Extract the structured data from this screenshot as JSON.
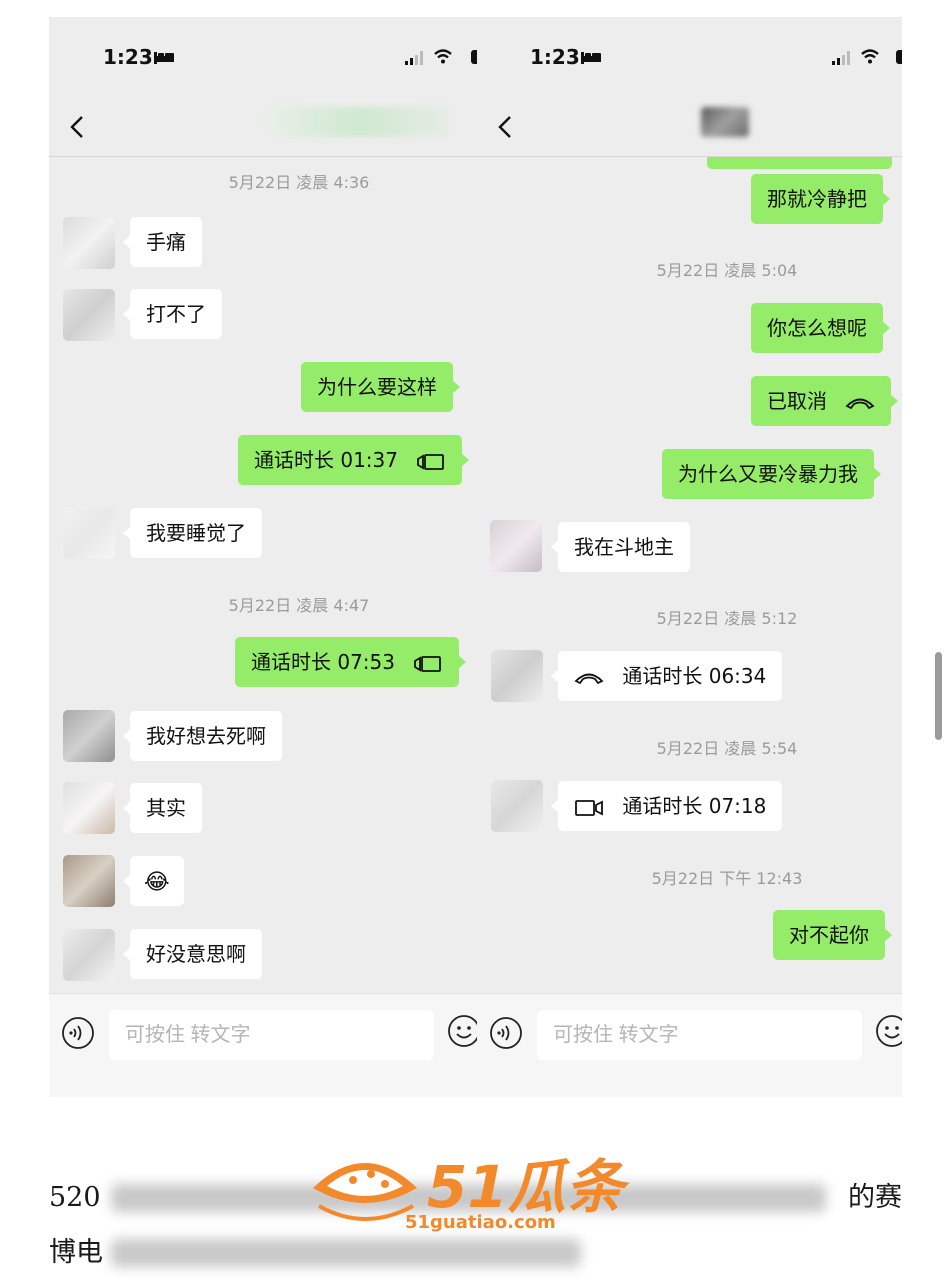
{
  "status_bar": {
    "time": "1:23"
  },
  "left_chat": {
    "timestamps": [
      "5月22日 凌晨 4:36",
      "5月22日 凌晨 4:47"
    ],
    "messages": [
      {
        "dir": "in",
        "text": "手痛"
      },
      {
        "dir": "in",
        "text": "打不了"
      },
      {
        "dir": "out",
        "text": "为什么要这样"
      },
      {
        "dir": "out",
        "text": "通话时长 01:37",
        "icon": "video-call-icon"
      },
      {
        "dir": "in",
        "text": "我要睡觉了"
      },
      {
        "dir": "out",
        "text": "通话时长 07:53",
        "icon": "video-call-icon"
      },
      {
        "dir": "in",
        "text": "我好想去死啊"
      },
      {
        "dir": "in",
        "text": "其实"
      },
      {
        "dir": "in",
        "text": "😂",
        "icon": "laughing-emoji-icon"
      },
      {
        "dir": "in",
        "text": "好没意思啊"
      }
    ]
  },
  "right_chat": {
    "timestamps": [
      "5月22日 凌晨 5:04",
      "5月22日 凌晨 5:12",
      "5月22日 凌晨 5:54",
      "5月22日 下午 12:43"
    ],
    "messages": [
      {
        "dir": "out",
        "text": "那就冷静把"
      },
      {
        "dir": "out",
        "text": "你怎么想呢"
      },
      {
        "dir": "out",
        "text": "已取消",
        "icon": "hangup-phone-icon"
      },
      {
        "dir": "out",
        "text": "为什么又要冷暴力我"
      },
      {
        "dir": "in",
        "text": "我在斗地主"
      },
      {
        "dir": "in",
        "text": "通话时长 06:34",
        "icon": "hangup-phone-icon"
      },
      {
        "dir": "in",
        "text": "通话时长 07:18",
        "icon": "video-call-icon"
      },
      {
        "dir": "out",
        "text": "对不起你"
      }
    ]
  },
  "input_bar": {
    "placeholder": "可按住 转文字"
  },
  "article": {
    "line1_start": "520",
    "line1_end": "的赛",
    "line2_start": "博电"
  },
  "watermark": {
    "brand": "51瓜条",
    "url": "51guatiao.com"
  },
  "colors": {
    "outgoing_bubble": "#95ec69",
    "incoming_bubble": "#ffffff",
    "chat_bg": "#ededed",
    "watermark": "#f28a2c"
  }
}
